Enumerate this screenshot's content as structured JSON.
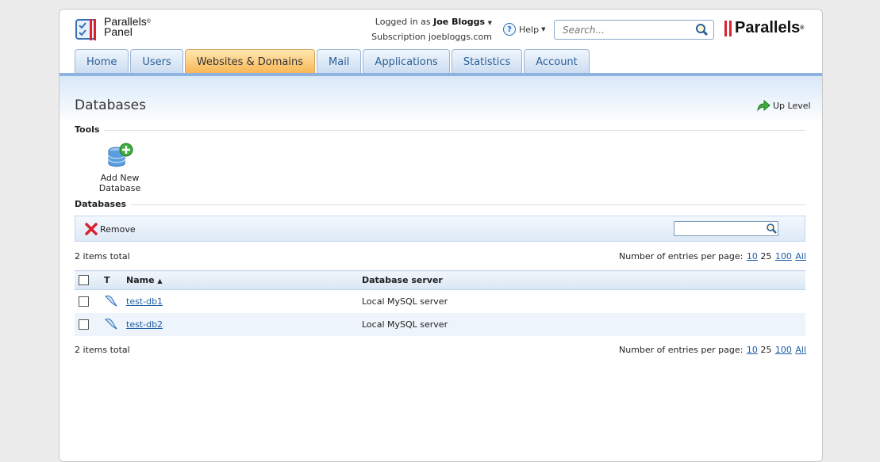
{
  "logo": {
    "line1": "Parallels",
    "line2": "Panel",
    "reg": "®"
  },
  "user": {
    "logged_in_prefix": "Logged in as",
    "name": "Joe Bloggs",
    "subscription_prefix": "Subscription",
    "subscription": "joebloggs.com"
  },
  "help": {
    "label": "Help"
  },
  "search": {
    "placeholder": "Search..."
  },
  "brand": {
    "name": "Parallels",
    "reg": "®"
  },
  "tabs": [
    {
      "label": "Home"
    },
    {
      "label": "Users"
    },
    {
      "label": "Websites & Domains",
      "active": true
    },
    {
      "label": "Mail"
    },
    {
      "label": "Applications"
    },
    {
      "label": "Statistics"
    },
    {
      "label": "Account"
    }
  ],
  "page": {
    "title": "Databases",
    "up_level": "Up Level"
  },
  "tools": {
    "heading": "Tools",
    "add_new_database": "Add New Database"
  },
  "databases": {
    "heading": "Databases",
    "remove_label": "Remove",
    "items_total": "2 items total",
    "per_page_label": "Number of entries per page:",
    "per_page_options": [
      "10",
      "25",
      "100",
      "All"
    ],
    "columns": {
      "type": "T",
      "name": "Name",
      "server": "Database server"
    },
    "rows": [
      {
        "name": "test-db1",
        "server": "Local MySQL server"
      },
      {
        "name": "test-db2",
        "server": "Local MySQL server"
      }
    ]
  },
  "colors": {
    "active_tab": "#f8b553",
    "tab": "#cbdcf0",
    "link": "#1d5fa3",
    "accent_bar": "#8fb3e0"
  }
}
